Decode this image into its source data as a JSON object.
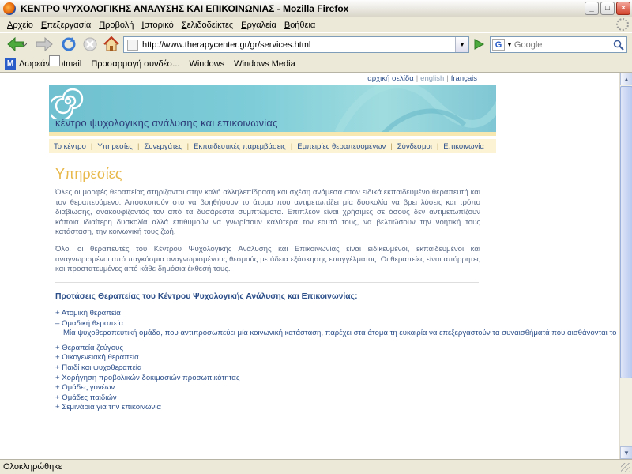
{
  "window": {
    "title": "ΚΕΝΤΡΟ ΨΥΧΟΛΟΓΙΚΗΣ ΑΝΑΛΥΣΗΣ ΚΑΙ ΕΠΙΚΟΙΝΩΝΙΑΣ - Mozilla Firefox",
    "minimize": "_",
    "maximize": "□",
    "close": "×"
  },
  "menu": [
    "Αρχείο",
    "Επεξεργασία",
    "Προβολή",
    "Ιστορικό",
    "Σελιδοδείκτες",
    "Εργαλεία",
    "Βοήθεια"
  ],
  "toolbar": {
    "url": "http://www.therapycenter.gr/gr/services.html",
    "search_placeholder": "Google",
    "search_engine": "G"
  },
  "bookmarks": [
    {
      "label": "Δωρεάν Hotmail",
      "icon": "hotmail-icon"
    },
    {
      "label": "Προσαρμογή συνδέσ...",
      "icon": "page-icon"
    },
    {
      "label": "Windows",
      "icon": "page-icon"
    },
    {
      "label": "Windows Media",
      "icon": "page-icon"
    }
  ],
  "status": "Ολοκληρώθηκε",
  "page": {
    "languages": {
      "greek": "αρχική σελίδα",
      "english": "english",
      "french": "français"
    },
    "site_title": "κέντρο ψυχολογικής ανάλυσης και επικοινωνίας",
    "nav": [
      "Το κέντρο",
      "Υπηρεσίες",
      "Συνεργάτες",
      "Εκπαιδευτικές παρεμβάσεις",
      "Εμπειρίες θεραπευομένων",
      "Σύνδεσμοι",
      "Επικοινωνία"
    ],
    "heading": "Υπηρεσίες",
    "paragraph1": "Όλες οι μορφές θεραπείας στηρίζονται στην καλή αλληλεπίδραση και σχέση ανάμεσα στον ειδικά εκπαιδευμένο θεραπευτή και τον θεραπευόμενο. Αποσκοπούν στο να βοηθήσουν το άτομο που αντιμετωπίζει μία δυσκολία να βρει λύσεις και τρόπο διαβίωσης, ανακουφίζοντάς τον από τα δυσάρεστα συμπτώματα. Επιπλέον είναι χρήσιμες σε όσους δεν αντιμετωπίζουν κάποια ιδιαίτερη δυσκολία αλλά επιθυμούν να γνωρίσουν καλύτερα τον εαυτό τους, να βελτιώσουν την νοητική τους κατάσταση, την κοινωνική τους ζωή.",
    "paragraph2": "Όλοι οι θεραπευτές του Κέντρου Ψυχολογικής Ανάλυσης και Επικοινωνίας είναι ειδικευμένοι, εκπαιδευμένοι και αναγνωρισμένοι από παγκόσμια αναγνωρισμένους θεσμούς με άδεια εξάσκησης επαγγέλματος. Οι θεραπείες είναι απόρρητες και προστατευμένες από κάθε δημόσια έκθεσή τους.",
    "proposals_heading": "Προτάσεις Θεραπείας του Κέντρου Ψυχολογικής Ανάλυσης και Επικοινωνίας:",
    "therapies": [
      "+ Ατομική θεραπεία",
      "– Ομαδική θεραπεία",
      "+ Θεραπεία ζεύγους",
      "+ Οικογενειακή θεραπεία",
      "+ Παιδί και ψυχοθεραπεία",
      "+ Χορήγηση προβολικών δοκιμασιών προσωπικότητας",
      "+ Ομάδες γονέων",
      "+ Ομάδες παιδιών",
      "+ Σεμινάρια για την επικοινωνία"
    ],
    "group_therapy_description": "Μία ψυχοθεραπευτική ομάδα, που αντιπροσωπεύει μία κοινωνική κατάσταση, παρέχει στα άτομα τη ευκαιρία να επεξεργαστούν τα συναισθήματά που αισθάνονται το ένα για το άλλο. Αναγνωρίζουν, συγκρίνουν και κατανοούν την συμπεριφορά τους απέναντι στα μέλη της ομάδας και κατ' επέκταση στην καθημερινή ζωή τους. Η ανάλυση αυτών των συμπεριφορών και των συναισθημάτων που προκύπτουν κατά την διάρκεια της συνάντησης με τους άλλους βοηθά το άτομο να επαναπροσδιορίσει τις σχέσεις του μέσα στην οικογένεια, στον εργασιακό χώρο, στον κοινωνικό του περίγυρο."
  }
}
